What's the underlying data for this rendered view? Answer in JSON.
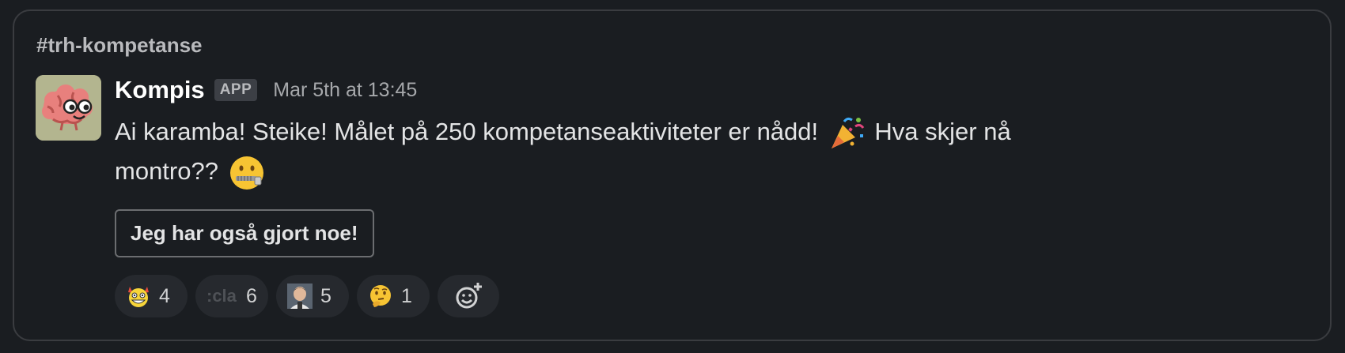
{
  "channel": "#trh-kompetanse",
  "message": {
    "sender": "Kompis",
    "badge": "APP",
    "timestamp": "Mar 5th at 13:45",
    "text_part1": "Ai karamba! Steike! Målet på 250 kompetanseaktiviteter er nådd!",
    "text_part2": "Hva skjer nå montro??",
    "inline_emojis": [
      "party-popper-icon",
      "zipper-mouth-face-icon"
    ]
  },
  "action_button": {
    "label": "Jeg har også gjort noe!"
  },
  "reactions": [
    {
      "icon": "devil-grin-icon",
      "count": "4"
    },
    {
      "icon": "cla-custom-emoji",
      "label": ":cla",
      "count": "6"
    },
    {
      "icon": "person-photo-icon",
      "count": "5"
    },
    {
      "icon": "thinking-face-icon",
      "count": "1"
    }
  ],
  "add_reaction_icon": "add-reaction-icon",
  "colors": {
    "background": "#1a1d21",
    "border": "#3a3c40",
    "avatar_bg": "#b3b58f",
    "reaction_bg": "#26292e"
  }
}
